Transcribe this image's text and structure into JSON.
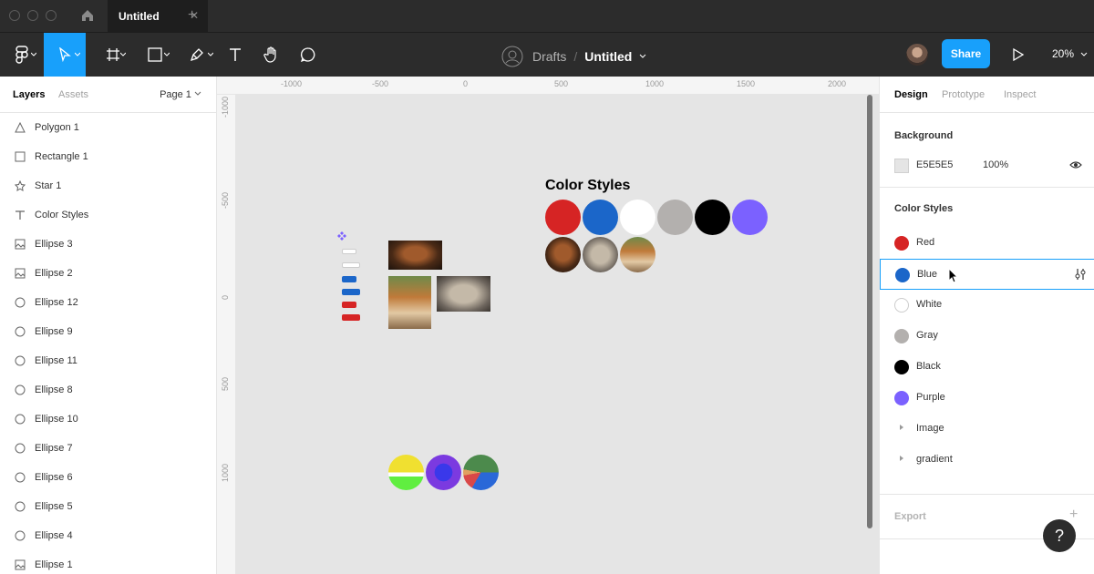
{
  "window": {
    "tab_title": "Untitled",
    "tab_close": "✕",
    "new_tab": "+"
  },
  "toolbar": {
    "breadcrumb_folder": "Drafts",
    "breadcrumb_sep": "/",
    "file_title": "Untitled",
    "share_label": "Share",
    "zoom": "20%"
  },
  "layers_panel": {
    "tab_layers": "Layers",
    "tab_assets": "Assets",
    "page": "Page 1",
    "items": [
      {
        "label": "Polygon 1",
        "icon": "polygon-icon"
      },
      {
        "label": "Rectangle 1",
        "icon": "rectangle-icon"
      },
      {
        "label": "Star 1",
        "icon": "star-icon"
      },
      {
        "label": "Color Styles",
        "icon": "text-icon"
      },
      {
        "label": "Ellipse 3",
        "icon": "image-icon"
      },
      {
        "label": "Ellipse 2",
        "icon": "image-icon"
      },
      {
        "label": "Ellipse 12",
        "icon": "ellipse-icon"
      },
      {
        "label": "Ellipse 9",
        "icon": "ellipse-icon"
      },
      {
        "label": "Ellipse 11",
        "icon": "ellipse-icon"
      },
      {
        "label": "Ellipse 8",
        "icon": "ellipse-icon"
      },
      {
        "label": "Ellipse 10",
        "icon": "ellipse-icon"
      },
      {
        "label": "Ellipse 7",
        "icon": "ellipse-icon"
      },
      {
        "label": "Ellipse 6",
        "icon": "ellipse-icon"
      },
      {
        "label": "Ellipse 5",
        "icon": "ellipse-icon"
      },
      {
        "label": "Ellipse 4",
        "icon": "ellipse-icon"
      },
      {
        "label": "Ellipse 1",
        "icon": "image-icon"
      }
    ]
  },
  "rulers": {
    "top": [
      "-1000",
      "-500",
      "0",
      "500",
      "1000",
      "1500",
      "2000"
    ],
    "left": [
      "-1000",
      "-500",
      "0",
      "500",
      "1000"
    ]
  },
  "canvas": {
    "heading": "Color Styles",
    "background": "#E5E5E5"
  },
  "design_panel": {
    "tab_design": "Design",
    "tab_prototype": "Prototype",
    "tab_inspect": "Inspect",
    "background_title": "Background",
    "background_hex": "E5E5E5",
    "background_opacity": "100%",
    "color_styles_title": "Color Styles",
    "styles": [
      {
        "label": "Red",
        "color": "#D62424"
      },
      {
        "label": "Blue",
        "color": "#1B66C9"
      },
      {
        "label": "White",
        "color": "#FFFFFF"
      },
      {
        "label": "Gray",
        "color": "#B3B0AE"
      },
      {
        "label": "Black",
        "color": "#000000"
      },
      {
        "label": "Purple",
        "color": "#7B61FF"
      }
    ],
    "folders": [
      "Image",
      "gradient"
    ],
    "export_title": "Export",
    "export_add": "+",
    "help": "?"
  }
}
